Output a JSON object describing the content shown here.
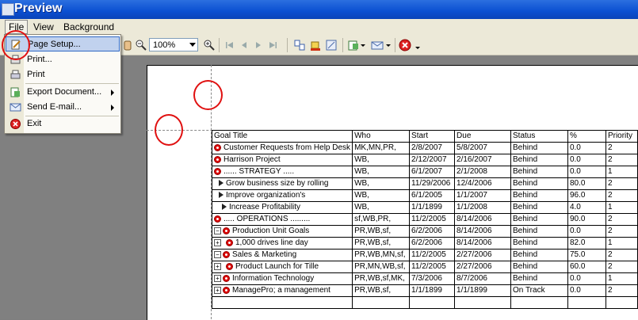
{
  "window": {
    "title": "Preview"
  },
  "menubar": {
    "file": "File",
    "view": "View",
    "background": "Background"
  },
  "toolbar": {
    "zoom": "100%"
  },
  "file_menu": {
    "items": [
      {
        "label": "Page Setup...",
        "icon": "page-setup-icon",
        "selected": true,
        "submenu": false
      },
      {
        "label": "Print...",
        "icon": "print-dialog-icon",
        "selected": false,
        "submenu": false
      },
      {
        "label": "Print",
        "icon": "printer-icon",
        "selected": false,
        "submenu": false
      },
      {
        "label": "Export Document...",
        "icon": "export-icon",
        "selected": false,
        "submenu": true
      },
      {
        "label": "Send E-mail...",
        "icon": "email-icon",
        "selected": false,
        "submenu": true
      },
      {
        "label": "Exit",
        "icon": "exit-icon",
        "selected": false,
        "submenu": false
      }
    ]
  },
  "report": {
    "columns": [
      "Goal Title",
      "Who",
      "Start",
      "Due",
      "Status",
      "%",
      "Priority"
    ],
    "rows": [
      {
        "goal": "Customer Requests from Help Desk",
        "who": "MK,MN,PR,",
        "start": "2/8/2007",
        "due": "5/8/2007",
        "status": "Behind",
        "pct": "0.0",
        "priority": "2"
      },
      {
        "goal": "Harrison Project",
        "who": "WB,",
        "start": "2/12/2007",
        "due": "2/16/2007",
        "status": "Behind",
        "pct": "0.0",
        "priority": "2"
      },
      {
        "goal": "...... STRATEGY .....",
        "who": "WB,",
        "start": "6/1/2007",
        "due": "2/1/2008",
        "status": "Behind",
        "pct": "0.0",
        "priority": "1"
      },
      {
        "goal": "Grow business size by rolling",
        "who": "WB,",
        "start": "11/29/2006",
        "due": "12/4/2006",
        "status": "Behind",
        "pct": "80.0",
        "priority": "2"
      },
      {
        "goal": "Improve organization's",
        "who": "WB,",
        "start": "6/1/2005",
        "due": "1/1/2007",
        "status": "Behind",
        "pct": "96.0",
        "priority": "2"
      },
      {
        "goal": "Increase Profitability",
        "who": "WB,",
        "start": "1/1/1899",
        "due": "1/1/2008",
        "status": "Behind",
        "pct": "4.0",
        "priority": "1"
      },
      {
        "goal": "..... OPERATIONS .........",
        "who": "sf,WB,PR,",
        "start": "11/2/2005",
        "due": "8/14/2006",
        "status": "Behind",
        "pct": "90.0",
        "priority": "2"
      },
      {
        "goal": "Production Unit Goals",
        "who": "PR,WB,sf,",
        "start": "6/2/2006",
        "due": "8/14/2006",
        "status": "Behind",
        "pct": "0.0",
        "priority": "2"
      },
      {
        "goal": "1,000 drives line day",
        "who": "PR,WB,sf,",
        "start": "6/2/2006",
        "due": "8/14/2006",
        "status": "Behind",
        "pct": "82.0",
        "priority": "1"
      },
      {
        "goal": "Sales & Marketing",
        "who": "PR,WB,MN,sf,",
        "start": "11/2/2005",
        "due": "2/27/2006",
        "status": "Behind",
        "pct": "75.0",
        "priority": "2"
      },
      {
        "goal": "Product Launch for Tille",
        "who": "PR,MN,WB,sf,",
        "start": "11/2/2005",
        "due": "2/27/2006",
        "status": "Behind",
        "pct": "60.0",
        "priority": "2"
      },
      {
        "goal": "Information Technology",
        "who": "PR,WB,sf,MK,",
        "start": "7/3/2006",
        "due": "8/7/2006",
        "status": "Behind",
        "pct": "0.0",
        "priority": "1"
      },
      {
        "goal": "ManagePro; a management",
        "who": "PR,WB,sf,",
        "start": "1/1/1899",
        "due": "1/1/1899",
        "status": "On Track",
        "pct": "0.0",
        "priority": "2"
      },
      {
        "goal": "",
        "who": "",
        "start": "",
        "due": "",
        "status": "",
        "pct": "",
        "priority": ""
      }
    ]
  },
  "colors": {
    "annotation": "#e01010",
    "titlebar": "#0a4fd1",
    "selection": "#c1d2ee"
  }
}
